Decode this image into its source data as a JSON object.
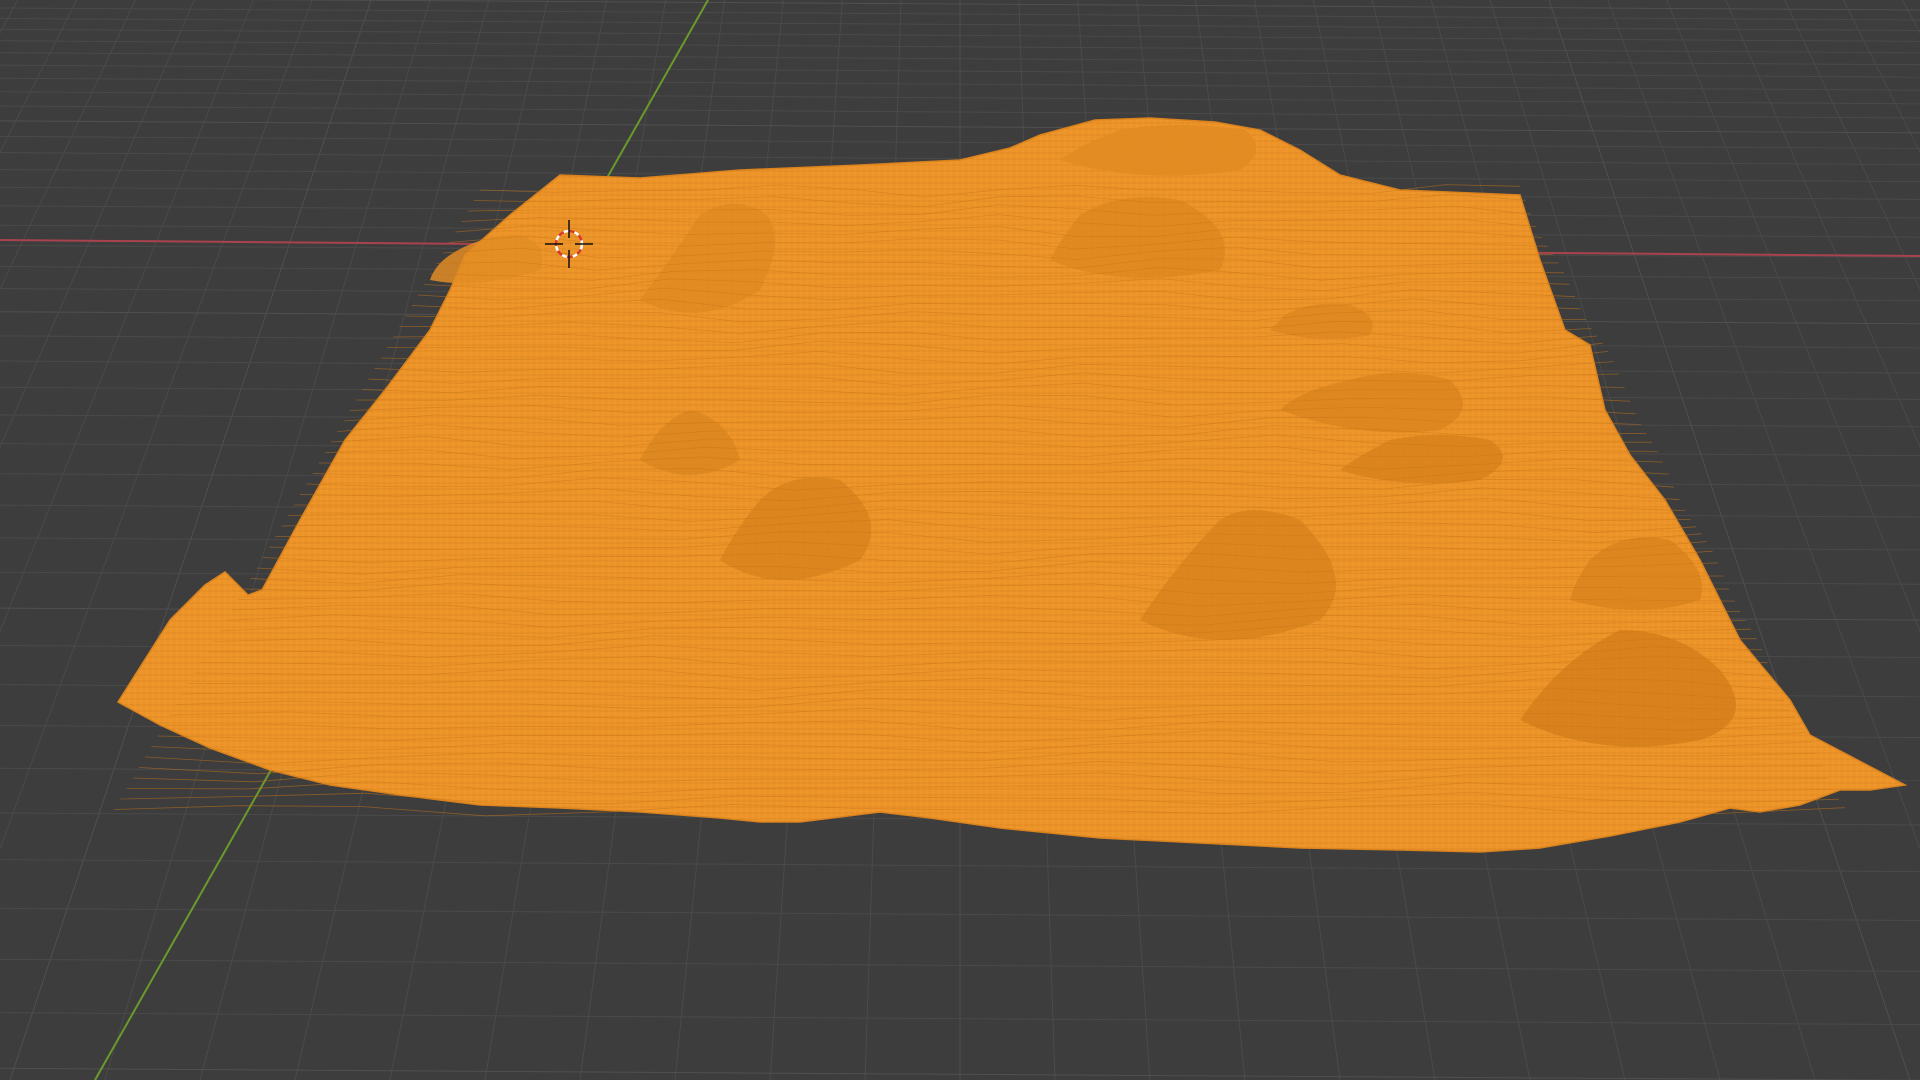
{
  "viewport": {
    "view": "3D Viewport",
    "shading": "wireframe",
    "background_color": "#3d3d3d",
    "grid_line_color": "#4a4a4a",
    "grid_major_color": "#505050",
    "x_axis_color": "#a8424f",
    "y_axis_color": "#6a9a2c"
  },
  "object": {
    "type": "terrain-mesh",
    "selected": true,
    "wire_color": "#f0962a",
    "wire_color_dark": "#d27c1a"
  },
  "cursor": {
    "name": "3d-cursor",
    "ring_colors": [
      "#ffffff",
      "#d83a2a"
    ]
  }
}
